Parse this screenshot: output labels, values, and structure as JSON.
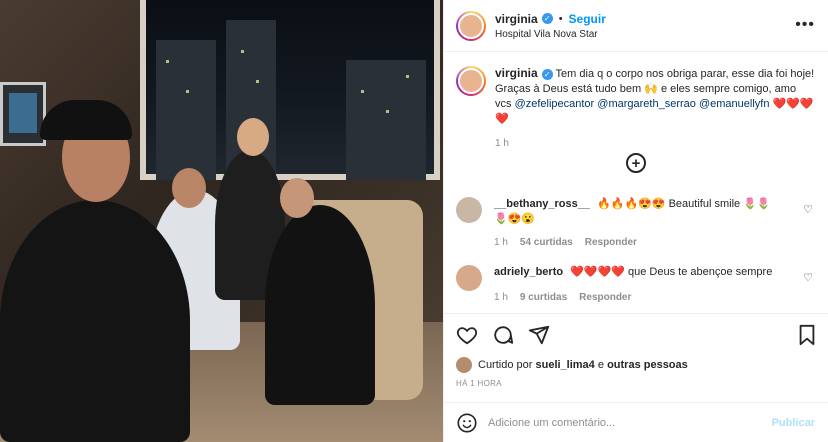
{
  "post": {
    "username": "virginia",
    "follow_label": "Seguir",
    "location": "Hospital Vila Nova Star",
    "more_icon": "more-horizontal-icon"
  },
  "caption": {
    "username": "virginia",
    "text": "Tem dia q o corpo nos obriga parar, esse dia foi hoje! Graças à Deus está tudo bem 🙌 e eles sempre comigo, amo vcs",
    "mentions": [
      "@zefelipecantor",
      "@margareth_serrao",
      "@emanuellyfn"
    ],
    "trailing_emojis": "❤️❤️❤️❤️",
    "time": "1 h"
  },
  "comments": [
    {
      "username": "__bethany_ross__",
      "text": "🔥🔥🔥😍😍 Beautiful smile 🌷🌷🌷😍😮",
      "time": "1 h",
      "likes": "54 curtidas",
      "reply": "Responder"
    },
    {
      "username": "adriely_berto",
      "text": "❤️❤️❤️❤️ que Deus te abençoe sempre",
      "time": "1 h",
      "likes": "9 curtidas",
      "reply": "Responder"
    }
  ],
  "likes": {
    "prefix": "Curtido por",
    "user": "sueli_lima4",
    "connector": "e",
    "others": "outras pessoas"
  },
  "timestamp": "HÁ 1 HORA",
  "add_comment": {
    "placeholder": "Adicione um comentário...",
    "publish_label": "Publicar"
  },
  "colors": {
    "accent": "#0095f6",
    "text": "#262626",
    "muted": "#8e8e8e",
    "verified": "#3897f0",
    "publish_disabled": "#b2dffc"
  }
}
